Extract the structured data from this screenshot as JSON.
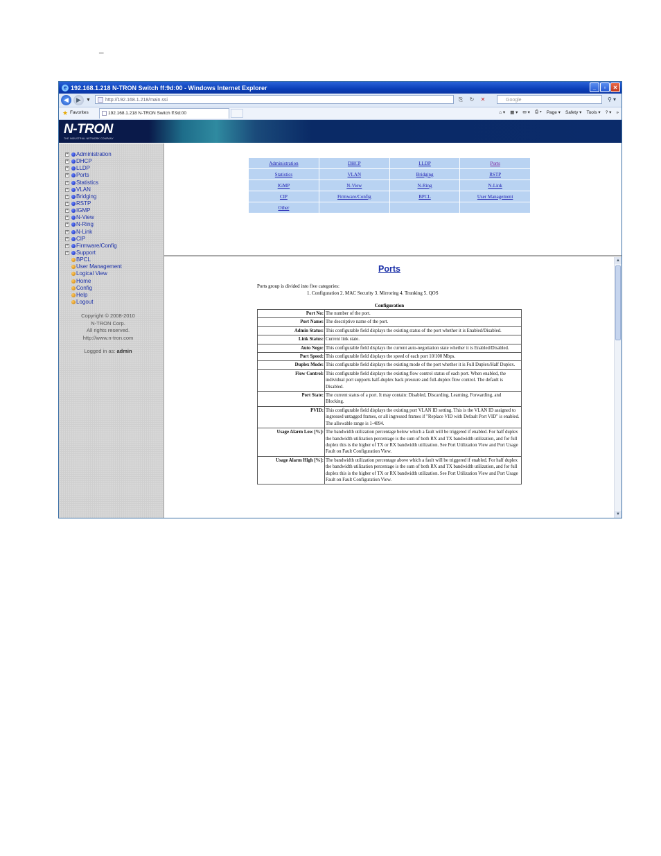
{
  "page_mark": "_",
  "window": {
    "title": "192.168.1.218 N-TRON Switch ff:9d:00 - Windows Internet Explorer",
    "address": "http://192.168.1.218/main.ssi",
    "search_placeholder": "Google",
    "favorites_label": "Favorites",
    "tab_title": "192.168.1.218 N-TRON Switch ff:9d:00",
    "commands": {
      "page": "Page ▾",
      "safety": "Safety ▾",
      "tools": "Tools ▾",
      "help": "? ▾"
    }
  },
  "banner": {
    "logo": "N-TRON",
    "tagline": "THE INDUSTRIAL NETWORK COMPANY"
  },
  "sidebar": {
    "items": [
      {
        "label": "Administration",
        "expandable": true,
        "dot": "blue"
      },
      {
        "label": "DHCP",
        "expandable": true,
        "dot": "blue"
      },
      {
        "label": "LLDP",
        "expandable": true,
        "dot": "blue"
      },
      {
        "label": "Ports",
        "expandable": true,
        "dot": "blue"
      },
      {
        "label": "Statistics",
        "expandable": true,
        "dot": "blue"
      },
      {
        "label": "VLAN",
        "expandable": true,
        "dot": "blue"
      },
      {
        "label": "Bridging",
        "expandable": true,
        "dot": "blue"
      },
      {
        "label": "RSTP",
        "expandable": true,
        "dot": "blue"
      },
      {
        "label": "IGMP",
        "expandable": true,
        "dot": "blue"
      },
      {
        "label": "N-View",
        "expandable": true,
        "dot": "blue"
      },
      {
        "label": "N-Ring",
        "expandable": true,
        "dot": "blue"
      },
      {
        "label": "N-Link",
        "expandable": true,
        "dot": "blue"
      },
      {
        "label": "CIP",
        "expandable": true,
        "dot": "blue"
      },
      {
        "label": "Firmware/Config",
        "expandable": true,
        "dot": "blue"
      },
      {
        "label": "Support",
        "expandable": true,
        "dot": "blue"
      },
      {
        "label": "BPCL",
        "expandable": false,
        "dot": "orange"
      },
      {
        "label": "User Management",
        "expandable": false,
        "dot": "orange"
      },
      {
        "label": "Logical View",
        "expandable": false,
        "dot": "orange"
      },
      {
        "label": "Home",
        "expandable": false,
        "dot": "orange"
      },
      {
        "label": "Config",
        "expandable": false,
        "dot": "orange"
      },
      {
        "label": "Help",
        "expandable": false,
        "dot": "orange"
      },
      {
        "label": "Logout",
        "expandable": false,
        "dot": "orange"
      }
    ],
    "copyright": [
      "Copyright © 2008-2010",
      "N-TRON Corp.",
      "All rights reserved.",
      "http://www.n-tron.com"
    ],
    "logged_in_prefix": "Logged in as:",
    "logged_in_user": "admin"
  },
  "nav_table": [
    [
      "Administration",
      "DHCP",
      "LLDP",
      "Ports"
    ],
    [
      "Statistics",
      "VLAN",
      "Bridging",
      "RSTP"
    ],
    [
      "IGMP",
      "N-View",
      "N-Ring",
      "N-Link"
    ],
    [
      "CIP",
      "Firmware/Config",
      "BPCL",
      "User Management"
    ],
    [
      "Other",
      "",
      "",
      ""
    ]
  ],
  "content": {
    "title": "Ports",
    "intro": "Ports group is divided into five categories:",
    "categories": "1. Configuration  2. MAC Security   3. Mirroring  4. Trunking  5. QOS",
    "section_caption": "Configuration",
    "rows": [
      {
        "key": "Port No:",
        "desc": "The number of the port."
      },
      {
        "key": "Port Name:",
        "desc": "The descriptive name of the port."
      },
      {
        "key": "Admin Status:",
        "desc": "This configurable field displays the existing status of the port whether it is Enabled/Disabled."
      },
      {
        "key": "Link Status:",
        "desc": "Current link state."
      },
      {
        "key": "Auto Nego:",
        "desc": "This configurable field displays the current auto-negotiation state whether it is Enabled/Disabled."
      },
      {
        "key": "Port Speed:",
        "desc": "This configurable field displays the speed of each port 10/100 Mbps."
      },
      {
        "key": "Duplex Mode:",
        "desc": "This configurable field displays the existing mode of the port whether it is Full Duplex/Half Duplex."
      },
      {
        "key": "Flow Control:",
        "desc": "This configurable field displays the existing flow control status of each port. When enabled, the individual port supports half-duplex back pressure and full-duplex flow control. The default is Disabled."
      },
      {
        "key": "Port State:",
        "desc": "The current status of a port. It may contain: Disabled, Discarding, Learning, Forwarding, and Blocking."
      },
      {
        "key": "PVID:",
        "desc": "This configurable field displays the existing port VLAN ID setting. This is the VLAN ID assigned to ingressed untagged frames, or all ingressed frames if \"Replace VID with Default Port VID\" is enabled. The allowable range is 1-4094."
      },
      {
        "key": "Usage Alarm Low [%]:",
        "desc": "The bandwidth utilization percentage below which a fault will be triggered if enabled. For half duplex the bandwidth utilization percentage is the sum of both RX and TX bandwidth utilization, and for full duplex this is the higher of TX or RX bandwidth utilization. See Port Utilization View and Port Usage Fault on Fault Configuration View."
      },
      {
        "key": "Usage Alarm High [%]:",
        "desc": "The bandwidth utilization percentage above which a fault will be triggered if enabled. For half duplex the bandwidth utilization percentage is the sum of both RX and TX bandwidth utilization, and for full duplex this is the higher of TX or RX bandwidth utilization. See Port Utilization View and Port Usage Fault on Fault Configuration View."
      }
    ]
  },
  "colors": {
    "link": "#1a2fa8",
    "banner": "#0a1a4a",
    "nav_cell": "#b9d3f2"
  }
}
